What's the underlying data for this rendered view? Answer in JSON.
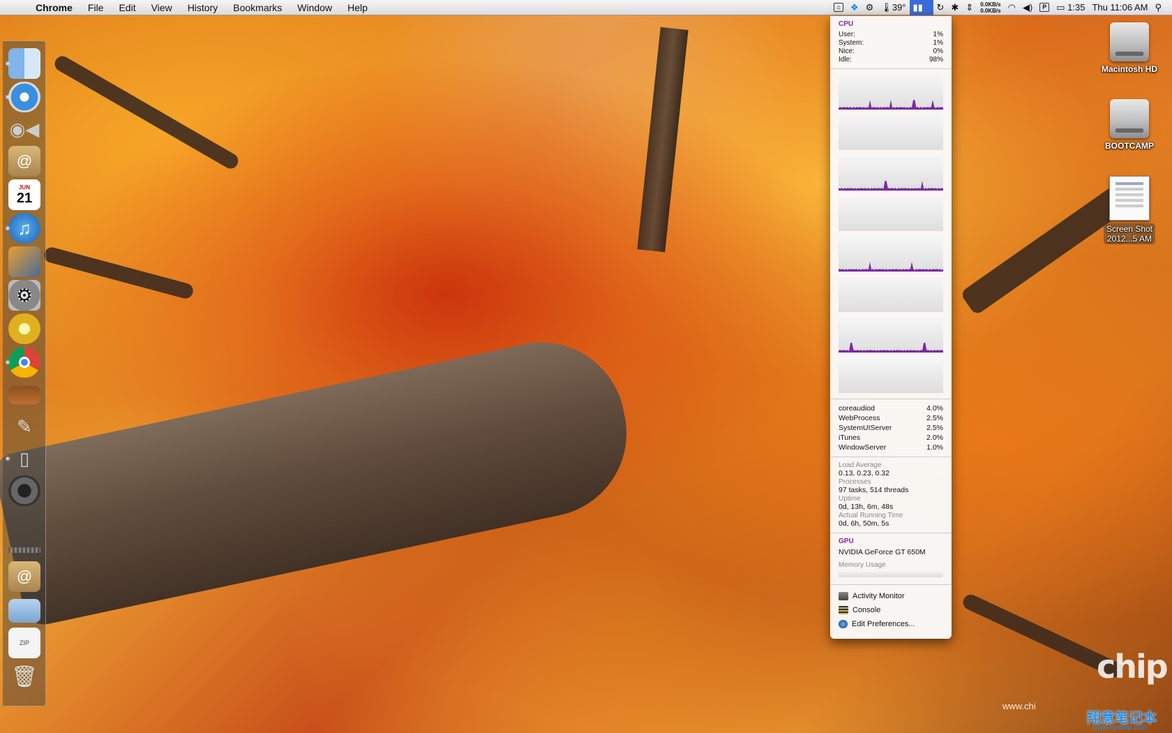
{
  "menubar": {
    "apple": "",
    "app_name": "Chrome",
    "menus": [
      "File",
      "Edit",
      "View",
      "History",
      "Bookmarks",
      "Window",
      "Help"
    ],
    "temperature": "39°",
    "net_up": "0.0KB/s",
    "net_down": "0.0KB/s",
    "battery_time": "1:35",
    "clock": "Thu 11:06 AM"
  },
  "dock": {
    "items": [
      "finder-icon",
      "safari-icon",
      "facetime-icon",
      "contacts-icon",
      "calendar-icon",
      "itunes-icon",
      "iphoto-icon",
      "system-preferences-icon",
      "aperture-icon",
      "chrome-icon",
      "book-icon",
      "preview-icon",
      "remote-icon",
      "photo-booth-icon",
      "mail-icon",
      "folder-icon",
      "archive-icon",
      "trash-icon"
    ],
    "calendar_date": "21",
    "calendar_month": "JUN"
  },
  "desktop": {
    "icons": [
      {
        "label": "Macintosh HD"
      },
      {
        "label": "BOOTCAMP"
      },
      {
        "label_line1": "Screen Shot",
        "label_line2": "2012...5 AM"
      }
    ]
  },
  "monitor": {
    "cpu": {
      "title": "CPU",
      "stats": [
        {
          "label": "User:",
          "value": "1%"
        },
        {
          "label": "System:",
          "value": "1%"
        },
        {
          "label": "Nice:",
          "value": "0%"
        },
        {
          "label": "Idle:",
          "value": "98%"
        }
      ]
    },
    "processes": [
      {
        "name": "coreaudiod",
        "value": "4.0%"
      },
      {
        "name": "WebProcess",
        "value": "2.5%"
      },
      {
        "name": "SystemUIServer",
        "value": "2.5%"
      },
      {
        "name": "iTunes",
        "value": "2.0%"
      },
      {
        "name": "WindowServer",
        "value": "1.0%"
      }
    ],
    "load_average_label": "Load Average",
    "load_average": "0.13, 0.23, 0.32",
    "processes_label": "Processes",
    "processes_value": "97 tasks, 514 threads",
    "uptime_label": "Uptime",
    "uptime": "0d, 13h, 6m, 48s",
    "running_label": "Actual Running Time",
    "running": "0d, 6h, 50m, 5s",
    "gpu_title": "GPU",
    "gpu_name": "NVIDIA GeForce GT 650M",
    "memory_label": "Memory Usage",
    "actions": [
      "Activity Monitor",
      "Console",
      "Edit Preferences..."
    ]
  },
  "watermark": {
    "logo": "chip hell",
    "url": "www.chi",
    "cn": "翔意笔记本",
    "cn_url": "www.xynbnb.com"
  },
  "colors": {
    "accent_purple": "#7b2aa0",
    "menubar_highlight": "#3a6bd6"
  }
}
